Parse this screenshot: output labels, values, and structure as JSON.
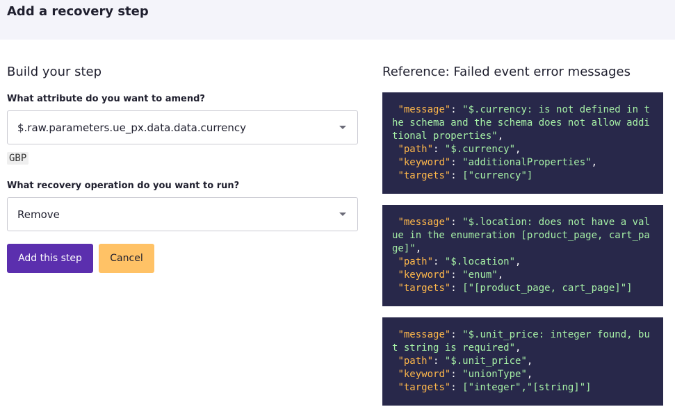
{
  "page": {
    "title": "Add a recovery step"
  },
  "builder": {
    "title": "Build your step",
    "attribute": {
      "label": "What attribute do you want to amend?",
      "value": "$.raw.parameters.ue_px.data.data.currency",
      "current_value": "GBP"
    },
    "operation": {
      "label": "What recovery operation do you want to run?",
      "value": "Remove"
    },
    "buttons": {
      "add": "Add this step",
      "cancel": "Cancel"
    }
  },
  "reference": {
    "title": "Reference: Failed event error messages",
    "errors": [
      {
        "message": "$.currency: is not defined in the schema and the schema does not allow additional properties",
        "path": "$.currency",
        "keyword": "additionalProperties",
        "targets": "[\"currency\"]"
      },
      {
        "message": "$.location: does not have a value in the enumeration [product_page, cart_page]",
        "path": "$.location",
        "keyword": "enum",
        "targets": "[\"[product_page, cart_page]\"]"
      },
      {
        "message": "$.unit_price: integer found, but string is required",
        "path": "$.unit_price",
        "keyword": "unionType",
        "targets": "[\"integer\",\"[string]\"]"
      }
    ]
  },
  "colors": {
    "primary": "#5b2fae",
    "cancel": "#ffc266",
    "code_bg": "#28284a",
    "code_key": "#ffb84a",
    "code_string": "#a6f0a6"
  }
}
